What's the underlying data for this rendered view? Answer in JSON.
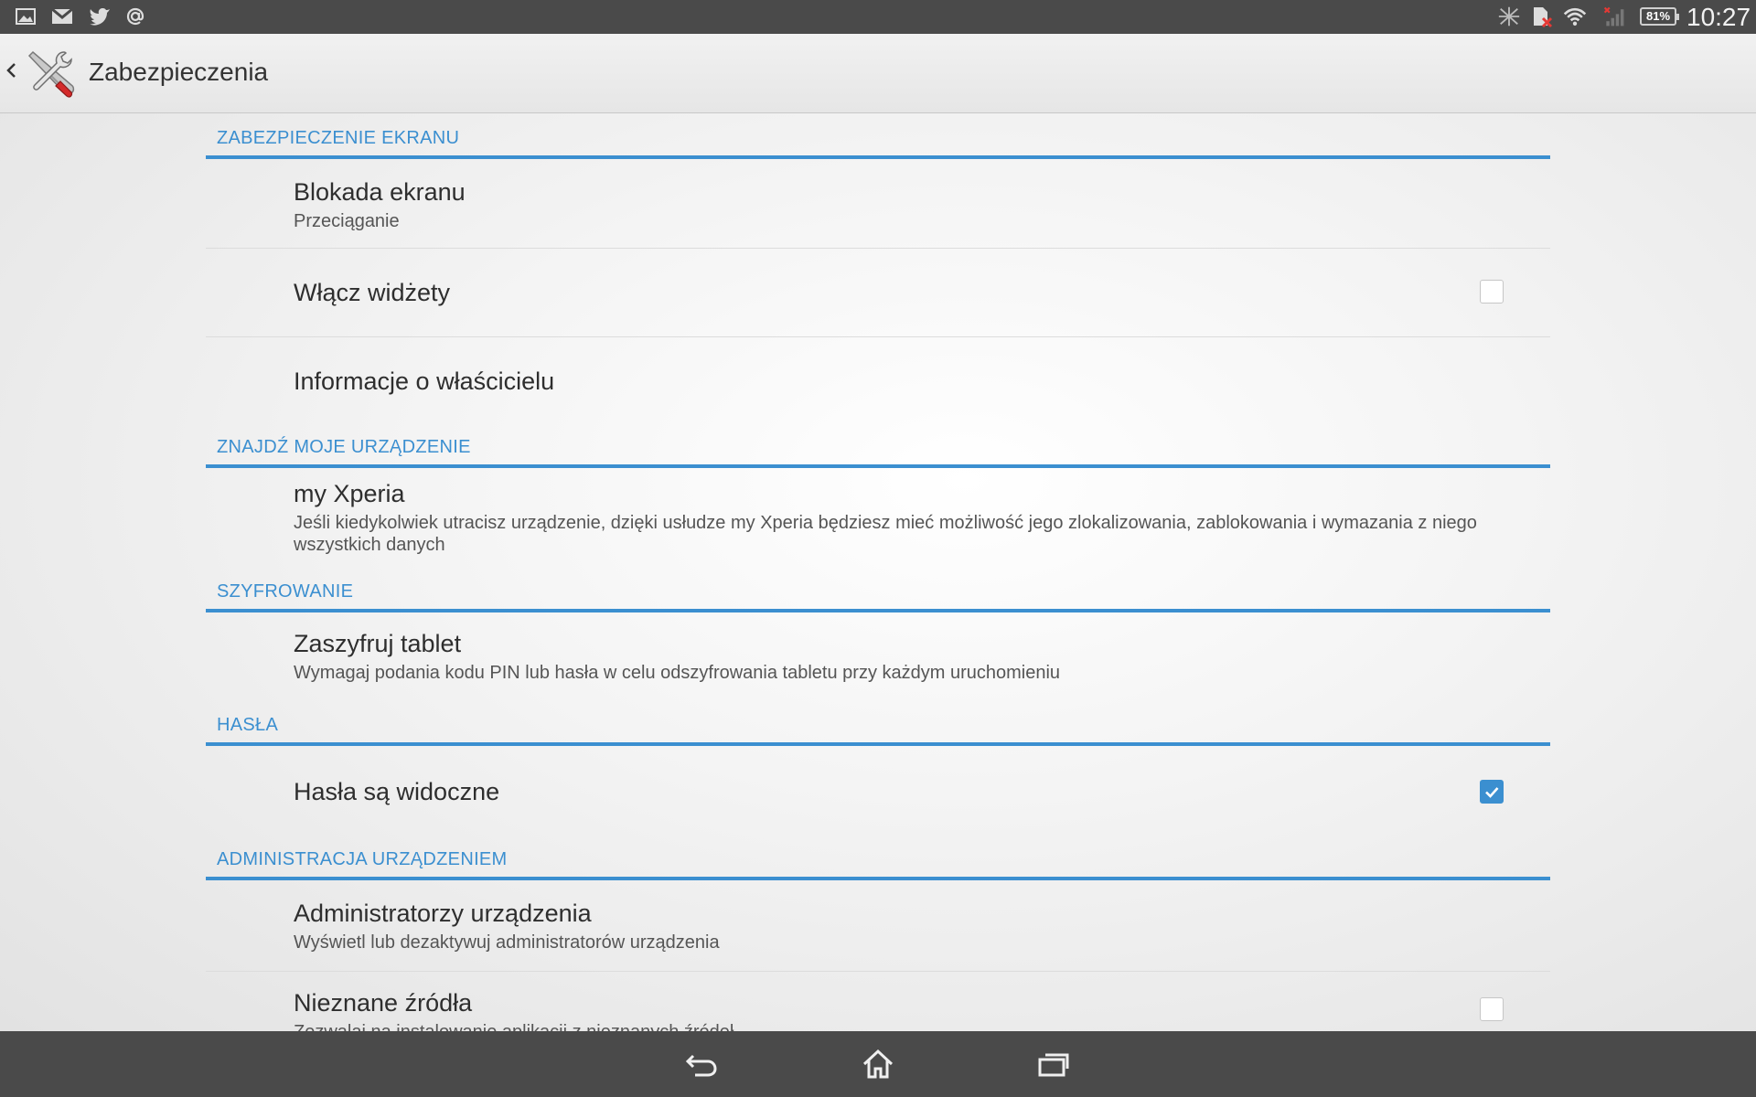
{
  "status_bar": {
    "left_icons": [
      "gallery-icon",
      "gmail-icon",
      "twitter-icon",
      "at-email-icon"
    ],
    "right_icons": [
      "nfc-off-icon",
      "sim-error-icon",
      "wifi-icon",
      "signal-icon"
    ],
    "battery": "81%",
    "time": "10:27"
  },
  "action_bar": {
    "title": "Zabezpieczenia",
    "back_icon": "chevron-left-icon",
    "app_icon": "tools-icon"
  },
  "sections": {
    "screen": {
      "header": "ZABEZPIECZENIE EKRANU",
      "items": [
        {
          "title": "Blokada ekranu",
          "subtitle": "Przeciąganie"
        },
        {
          "title": "Włącz widżety",
          "checked": false
        },
        {
          "title": "Informacje o właścicielu"
        }
      ]
    },
    "find": {
      "header": "ZNAJDŹ MOJE URZĄDZENIE",
      "items": [
        {
          "title": "my Xperia",
          "subtitle": "Jeśli kiedykolwiek utracisz urządzenie, dzięki usłudze my Xperia będziesz mieć możliwość jego zlokalizowania, zablokowania i wymazania z niego wszystkich danych"
        }
      ]
    },
    "encryption": {
      "header": "SZYFROWANIE",
      "items": [
        {
          "title": "Zaszyfruj tablet",
          "subtitle": "Wymagaj podania kodu PIN lub hasła w celu odszyfrowania tabletu przy każdym uruchomieniu"
        }
      ]
    },
    "passwords": {
      "header": "HASŁA",
      "items": [
        {
          "title": "Hasła są widoczne",
          "checked": true
        }
      ]
    },
    "admin": {
      "header": "ADMINISTRACJA URZĄDZENIEM",
      "items": [
        {
          "title": "Administratorzy urządzenia",
          "subtitle": "Wyświetl lub dezaktywuj administratorów urządzenia"
        },
        {
          "title": "Nieznane źródła",
          "subtitle": "Zezwalaj na instalowanie aplikacji z nieznanych źródeł",
          "checked": false
        }
      ]
    }
  },
  "nav_bar": {
    "buttons": [
      "back-icon",
      "home-icon",
      "recent-apps-icon"
    ]
  },
  "colors": {
    "accent": "#3b8fd0",
    "bars": "#4a4a4a"
  }
}
